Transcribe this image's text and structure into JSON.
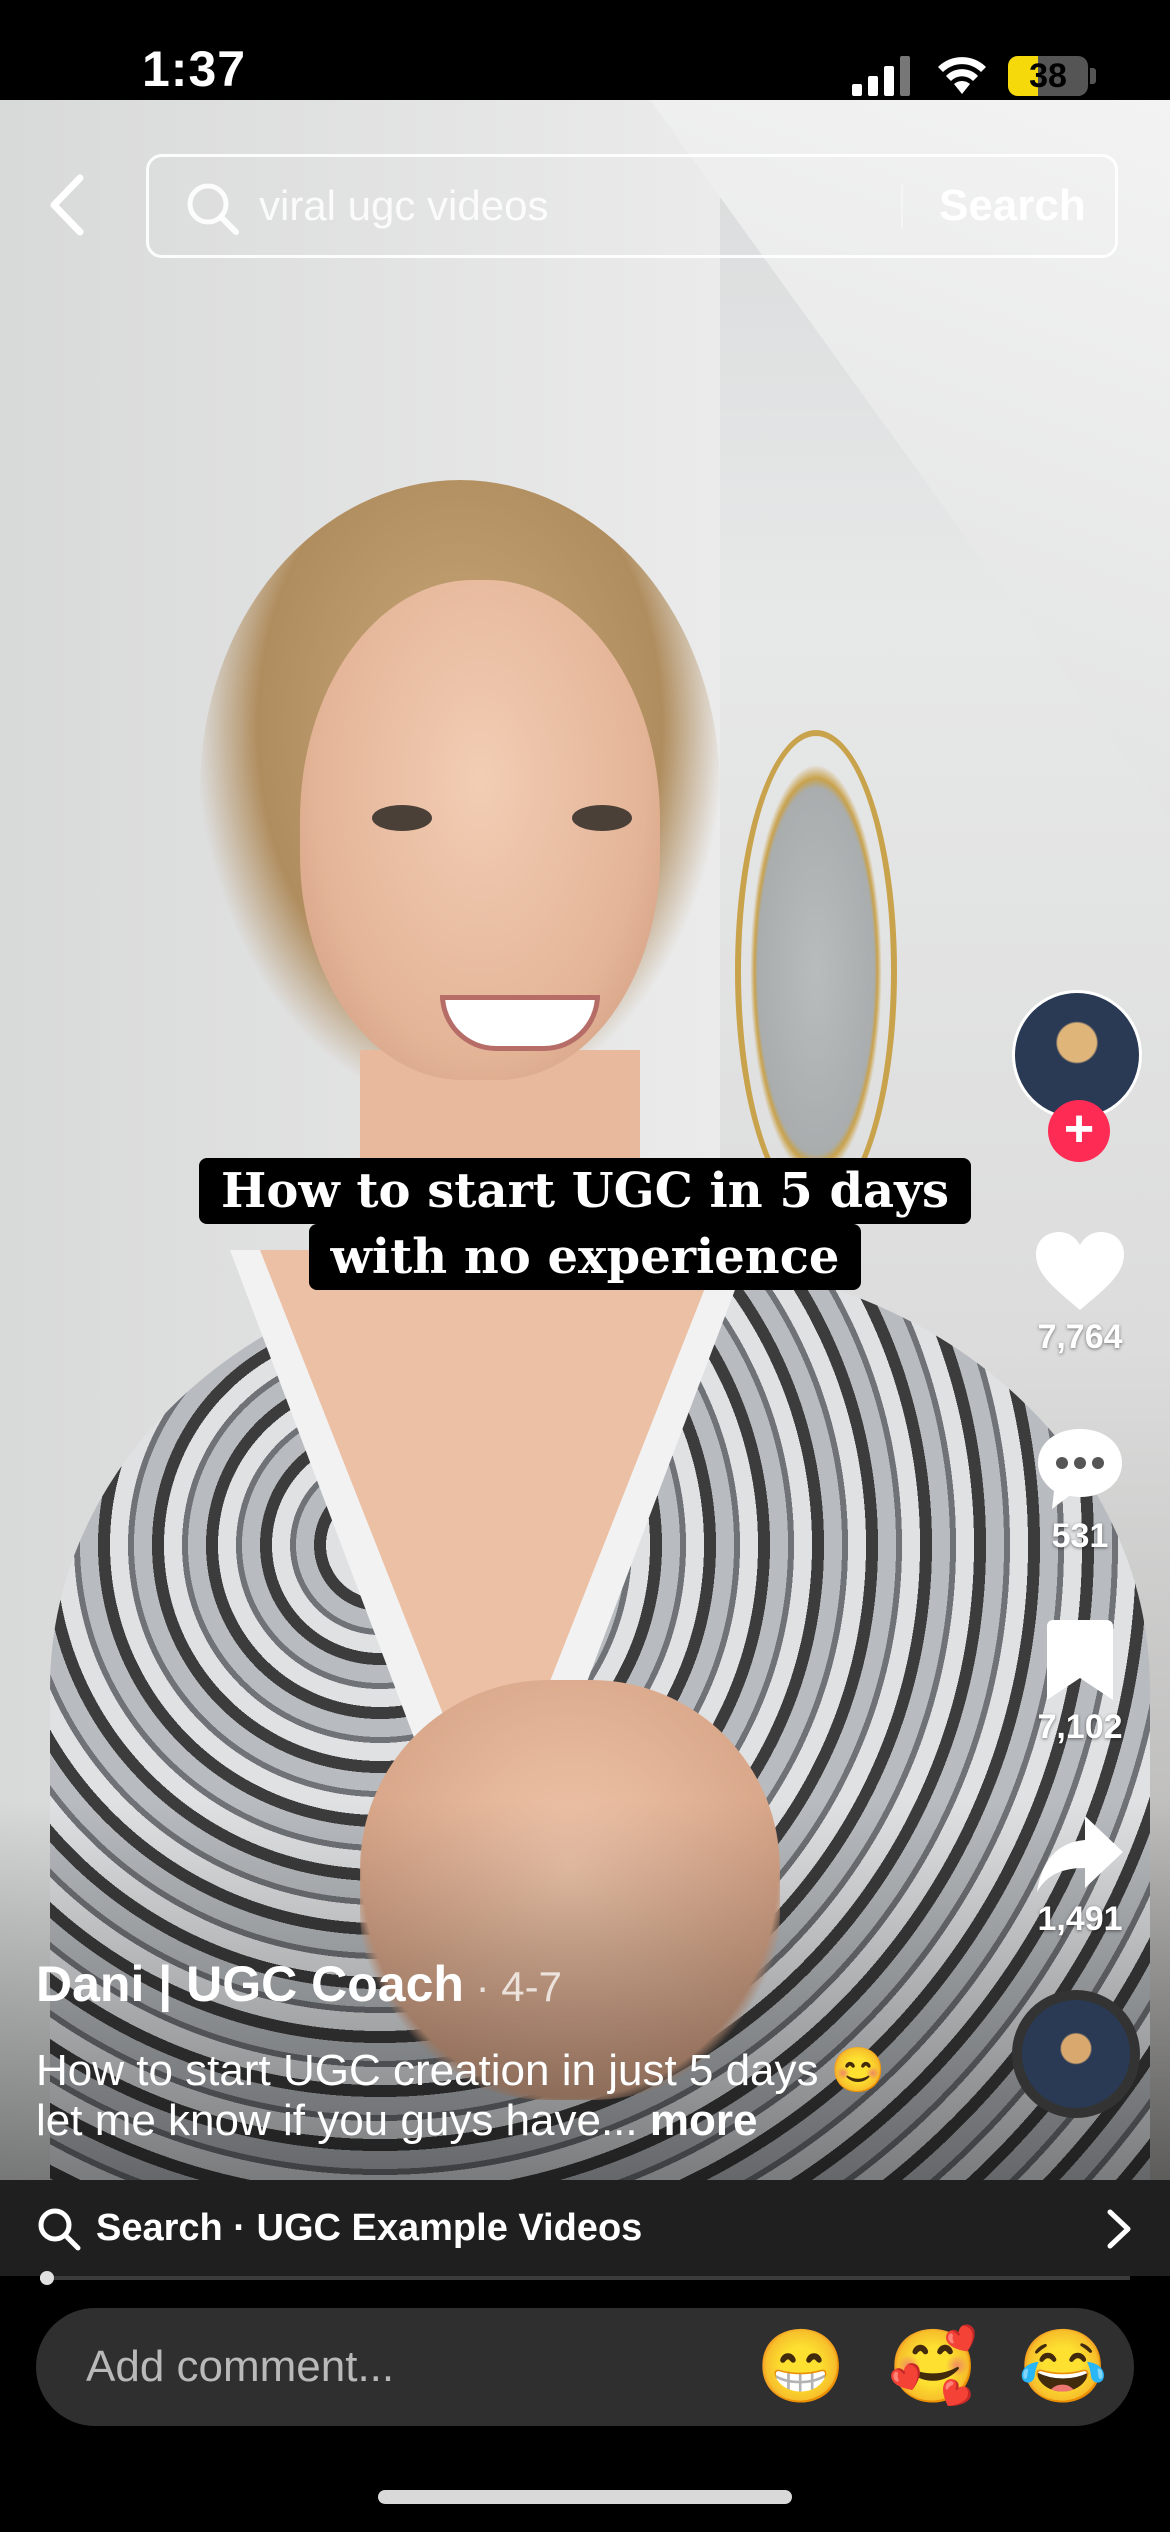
{
  "status_bar": {
    "time": "1:37",
    "battery": "38",
    "battery_level": 0.38
  },
  "search": {
    "query": "viral ugc videos",
    "button_label": "Search"
  },
  "video": {
    "caption_lines": [
      "How to start UGC in 5 days",
      "with no experience"
    ]
  },
  "actions": {
    "likes": "7,764",
    "comments": "531",
    "saves": "7,102",
    "shares": "1,491"
  },
  "post": {
    "username": "Dani | UGC Coach",
    "date": " · 4-7",
    "description": "How to start UGC creation in just 5 days 😊 let me know if you guys have... ",
    "more_label": "more"
  },
  "related_search": {
    "label": "Search · UGC Example Videos"
  },
  "progress": {
    "fraction": 0.01
  },
  "comment_bar": {
    "placeholder": "Add comment...",
    "emojis": [
      "😁",
      "🥰",
      "😂"
    ]
  },
  "colors": {
    "follow": "#fe2c55",
    "battery": "#f5d90a"
  }
}
